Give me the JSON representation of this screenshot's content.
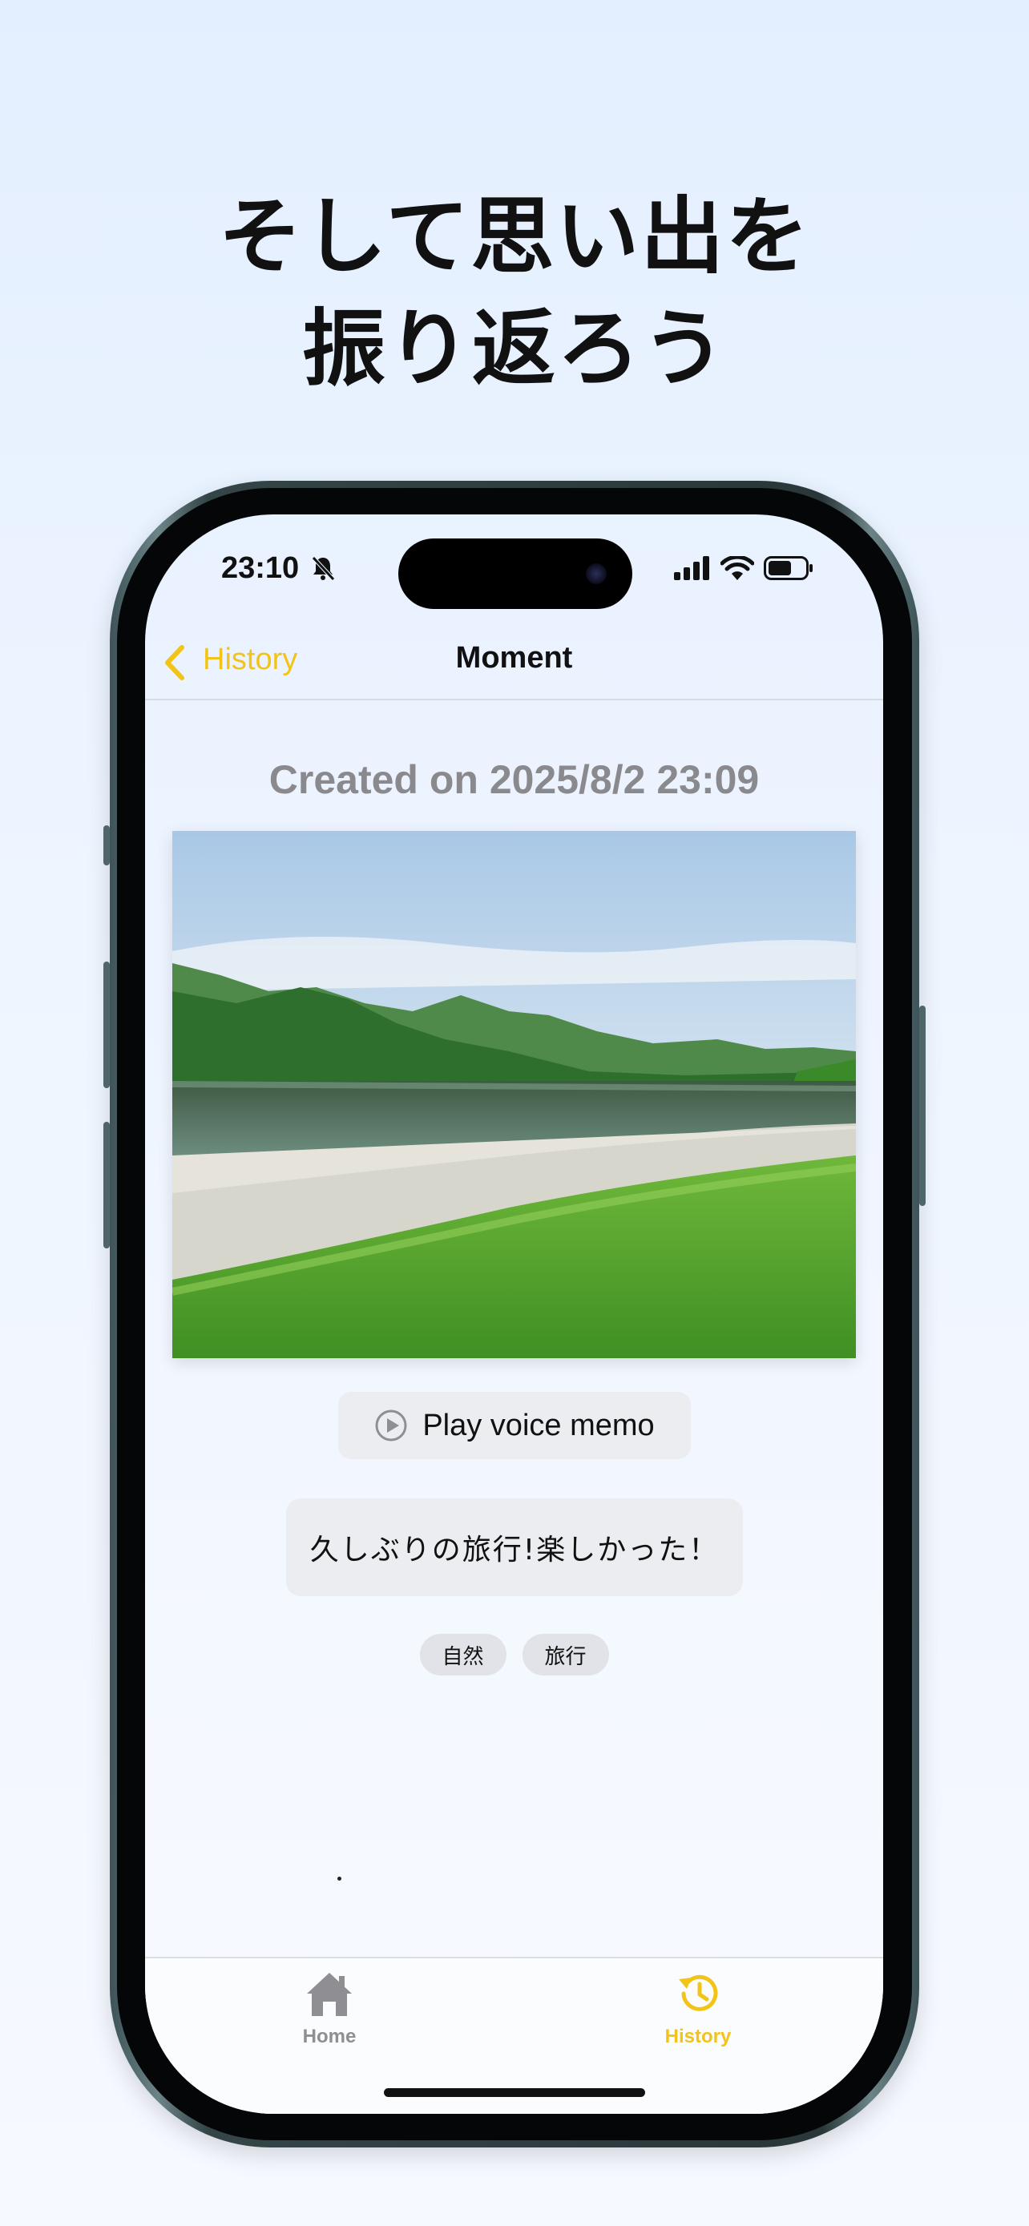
{
  "headline": {
    "line1": "そして思い出を",
    "line2": "振り返ろう"
  },
  "status_bar": {
    "time": "23:10",
    "icons": [
      "bell-slash-icon",
      "cellular-icon",
      "wifi-icon",
      "battery-icon"
    ]
  },
  "navbar": {
    "back_label": "History",
    "title": "Moment"
  },
  "moment": {
    "created": "Created on 2025/8/2 23:09",
    "play_label": "Play voice memo",
    "memo": "久しぶりの旅行!楽しかった！",
    "tags": [
      "自然",
      "旅行"
    ]
  },
  "tabbar": {
    "items": [
      {
        "label": "Home",
        "icon": "house-icon",
        "active": false
      },
      {
        "label": "History",
        "icon": "history-clock-icon",
        "active": true
      }
    ]
  },
  "colors": {
    "accent": "#f2c418",
    "inactive": "#8e8e93"
  }
}
